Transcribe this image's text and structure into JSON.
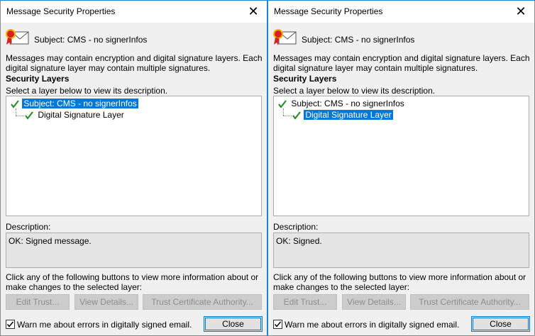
{
  "dialogs": [
    {
      "title": "Message Security Properties",
      "subject_line": "Subject:  CMS - no signerInfos",
      "intro_text": "Messages may contain encryption and digital signature layers. Each digital signature layer may contain multiple signatures.",
      "security_layers_heading": "Security Layers",
      "select_hint": "Select a layer below to view its description.",
      "tree": [
        {
          "label": "Subject: CMS - no signerInfos",
          "selected": true
        },
        {
          "label": "Digital Signature Layer",
          "selected": false
        }
      ],
      "description_label": "Description:",
      "description_value": "OK: Signed message.",
      "info_text": "Click any of the following buttons to view more information about or make changes to the selected layer:",
      "buttons": {
        "edit_trust": "Edit Trust...",
        "view_details": "View Details...",
        "trust_ca": "Trust Certificate Authority..."
      },
      "warn_label": "Warn me about errors in digitally signed email.",
      "warn_checked": true,
      "close_label": "Close"
    },
    {
      "title": "Message Security Properties",
      "subject_line": "Subject:  CMS - no signerInfos",
      "intro_text": "Messages may contain encryption and digital signature layers. Each digital signature layer may contain multiple signatures.",
      "security_layers_heading": "Security Layers",
      "select_hint": "Select a layer below to view its description.",
      "tree": [
        {
          "label": "Subject: CMS - no signerInfos",
          "selected": false
        },
        {
          "label": "Digital Signature Layer",
          "selected": true
        }
      ],
      "description_label": "Description:",
      "description_value": "OK: Signed.",
      "info_text": "Click any of the following buttons to view more information about or make changes to the selected layer:",
      "buttons": {
        "edit_trust": "Edit Trust...",
        "view_details": "View Details...",
        "trust_ca": "Trust Certificate Authority..."
      },
      "warn_label": "Warn me about errors in digitally signed email.",
      "warn_checked": true,
      "close_label": "Close"
    }
  ],
  "icons": {
    "close": "close-icon",
    "certificate": "signed-envelope-icon",
    "check": "green-check-icon"
  },
  "colors": {
    "selection": "#0078d7",
    "check": "#2e8b2e",
    "accent_border": "#1883d7"
  }
}
